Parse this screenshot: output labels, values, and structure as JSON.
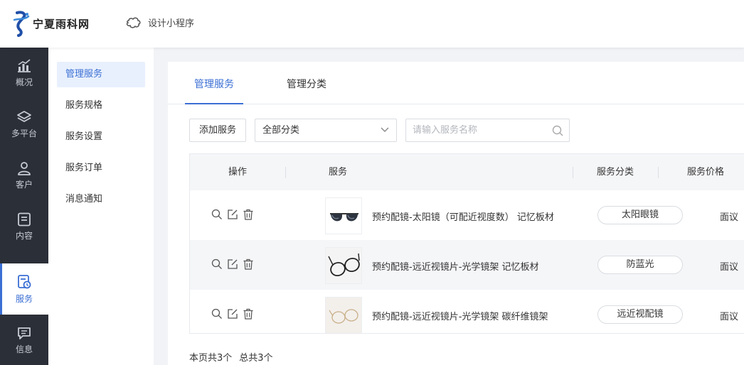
{
  "brand": {
    "name": "宁夏雨科网"
  },
  "header": {
    "design_link": "设计小程序"
  },
  "rail": {
    "items": [
      {
        "label": "概况",
        "icon": "chart-icon"
      },
      {
        "label": "多平台",
        "icon": "layers-icon"
      },
      {
        "label": "客户",
        "icon": "user-icon"
      },
      {
        "label": "内容",
        "icon": "document-icon"
      },
      {
        "label": "服务",
        "icon": "service-icon",
        "active": true
      },
      {
        "label": "信息",
        "icon": "message-icon"
      }
    ]
  },
  "submenu": {
    "items": [
      {
        "label": "管理服务",
        "active": true
      },
      {
        "label": "服务规格"
      },
      {
        "label": "服务设置"
      },
      {
        "label": "服务订单"
      },
      {
        "label": "消息通知"
      }
    ]
  },
  "tabs": [
    {
      "label": "管理服务",
      "active": true
    },
    {
      "label": "管理分类"
    }
  ],
  "toolbar": {
    "add_label": "添加服务",
    "category_select": "全部分类",
    "search_placeholder": "请输入服务名称"
  },
  "table": {
    "headers": {
      "ops": "操作",
      "service": "服务",
      "category": "服务分类",
      "price": "服务价格"
    },
    "rows": [
      {
        "name": "预约配镜-太阳镜（可配近视度数） 记忆板材",
        "category": "太阳眼镜",
        "price": "面议"
      },
      {
        "name": "预约配镜-远近视镜片-光学镜架 记忆板材",
        "category": "防蓝光",
        "price": "面议"
      },
      {
        "name": "预约配镜-远近视镜片-光学镜架 碳纤维镜架",
        "category": "远近视配镜",
        "price": "面议"
      }
    ]
  },
  "footer": {
    "page_count": "本页共3个",
    "total_count": "总共3个"
  },
  "colors": {
    "accent": "#3b6fd4",
    "rail_bg": "#2b2f38",
    "page_bg": "#f1f3f6"
  }
}
